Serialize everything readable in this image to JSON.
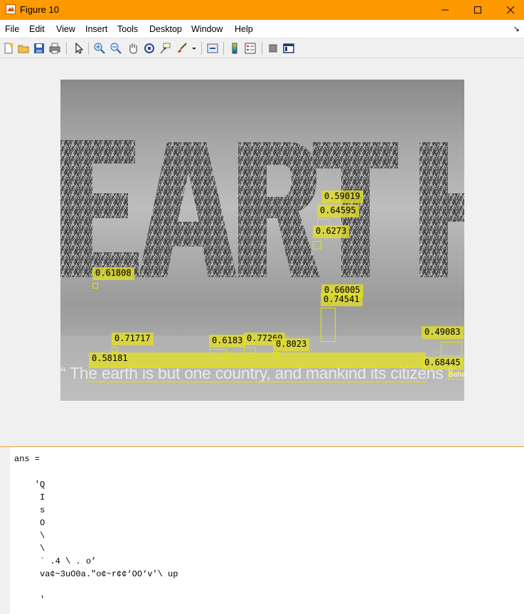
{
  "window": {
    "title": "Figure 10"
  },
  "menu": [
    "File",
    "Edit",
    "View",
    "Insert",
    "Tools",
    "Desktop",
    "Window",
    "Help"
  ],
  "toolbar": {
    "icons": [
      "new-figure-icon",
      "open-file-icon",
      "save-icon",
      "print-icon",
      "pointer-icon",
      "zoom-in-icon",
      "zoom-out-icon",
      "pan-icon",
      "rotate-3d-icon",
      "data-cursor-icon",
      "brush-icon",
      "link-plot-icon",
      "colorbar-icon",
      "legend-icon",
      "hide-plot-tools-icon",
      "show-plot-tools-icon"
    ]
  },
  "image": {
    "quote": "“ The earth is but one country, and mankind its citizens ”",
    "signature": "Baha",
    "detections": [
      {
        "label": "0.59019"
      },
      {
        "label": "0.64595"
      },
      {
        "label": "0.6273"
      },
      {
        "label": "0.61808"
      },
      {
        "label": "0.66005"
      },
      {
        "label": "0.74541"
      },
      {
        "label": "0.71717"
      },
      {
        "label": "0.6183"
      },
      {
        "label": "0.77269"
      },
      {
        "label": "0.8023"
      },
      {
        "label": "0.58181"
      },
      {
        "label": "0.49083"
      },
      {
        "label": "0.68445"
      }
    ]
  },
  "command_window": {
    "lines": [
      "ans =",
      "",
      "    'Q",
      "     I",
      "     s",
      "     O",
      "     \\",
      "     \\",
      "     ` .4 \\ . o’",
      "     va¢~3uO0a.\"o¢~r¢¢‘OO‘v'\\ up",
      "",
      "     '"
    ]
  }
}
